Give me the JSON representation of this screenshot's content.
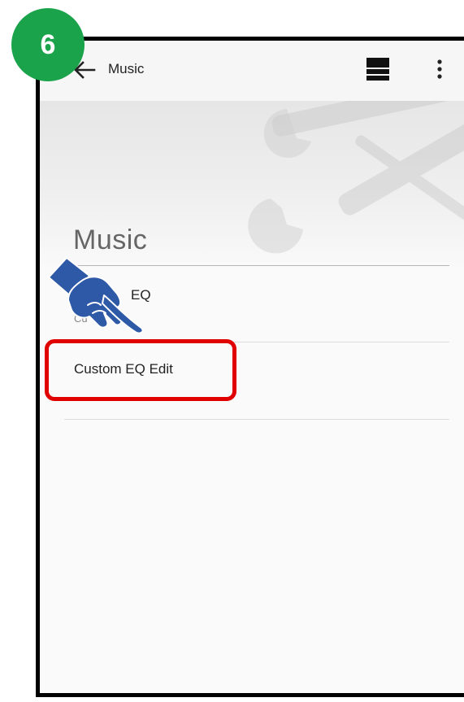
{
  "step": {
    "number": "6"
  },
  "toolbar": {
    "title": "Music"
  },
  "section": {
    "title": "Music"
  },
  "list": {
    "preset": {
      "title_fragment": "EQ",
      "subtitle_fragment": "Cu"
    },
    "custom_edit": {
      "title": "Custom EQ Edit"
    }
  },
  "colors": {
    "badge": "#1aa34a",
    "highlight": "#e00000",
    "hand": "#2d59a6",
    "frame": "#000000"
  },
  "icons": {
    "back": "arrow-left",
    "view": "list-view",
    "more": "more-vertical",
    "pointer": "pointing-hand"
  }
}
